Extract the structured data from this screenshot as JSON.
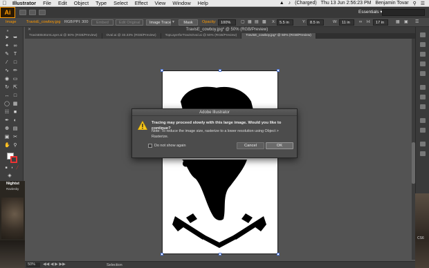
{
  "menubar": {
    "apple": "",
    "items": [
      "Illustrator",
      "File",
      "Edit",
      "Object",
      "Type",
      "Select",
      "Effect",
      "View",
      "Window",
      "Help"
    ],
    "battery": "(Charged)",
    "datetime": "Thu 13 Jun   2:56:23 PM",
    "user": "Benjamin Tovar"
  },
  "appbar": {
    "logo": "Ai",
    "workspace": "Essentials"
  },
  "control": {
    "image_label": "Image",
    "filename": "TravisE_cowboy.jpg",
    "color_mode": "RGB",
    "ppi": "PPI: 300",
    "embed": "Embed",
    "edit_original": "Edit Original",
    "image_trace": "Image Trace",
    "mask": "Mask",
    "opacity_label": "Opacity:",
    "opacity": "100%",
    "x_label": "X:",
    "x": "5.5 in",
    "y_label": "Y:",
    "y": "8.5 in",
    "w_label": "W:",
    "w": "11 in",
    "h_label": "H:",
    "h": "17 in"
  },
  "document": {
    "title": "TravisE_cowboy.jpg* @ 50% (RGB/Preview)",
    "tabs": [
      {
        "label": "TravisEBottomLayer.ai @ 50% (RGB/Preview)",
        "active": false
      },
      {
        "label": "Oval.ai @ 33.33% (RGB/Preview)",
        "active": false
      },
      {
        "label": "TopLayerforTravisOval.ai @ 50% (RGB/Preview)",
        "active": false
      },
      {
        "label": "TravisE_cowboy.jpg* @ 50% (RGB/Preview)",
        "active": true
      }
    ]
  },
  "dialog": {
    "title": "Adobe Illustrator",
    "message": "Tracing may proceed slowly with this large image. Would you like to continue?",
    "note": "Note: To reduce the image size, rasterize to a lower resolution using Object > Rasterize.",
    "checkbox_label": "Do not show again",
    "cancel": "Cancel",
    "ok": "OK"
  },
  "status": {
    "zoom": "50%",
    "tool": "Selection"
  },
  "video": {
    "title": "Nightst",
    "subtitle": "Ravlesky"
  },
  "badge": {
    "cs6": "CS6"
  }
}
